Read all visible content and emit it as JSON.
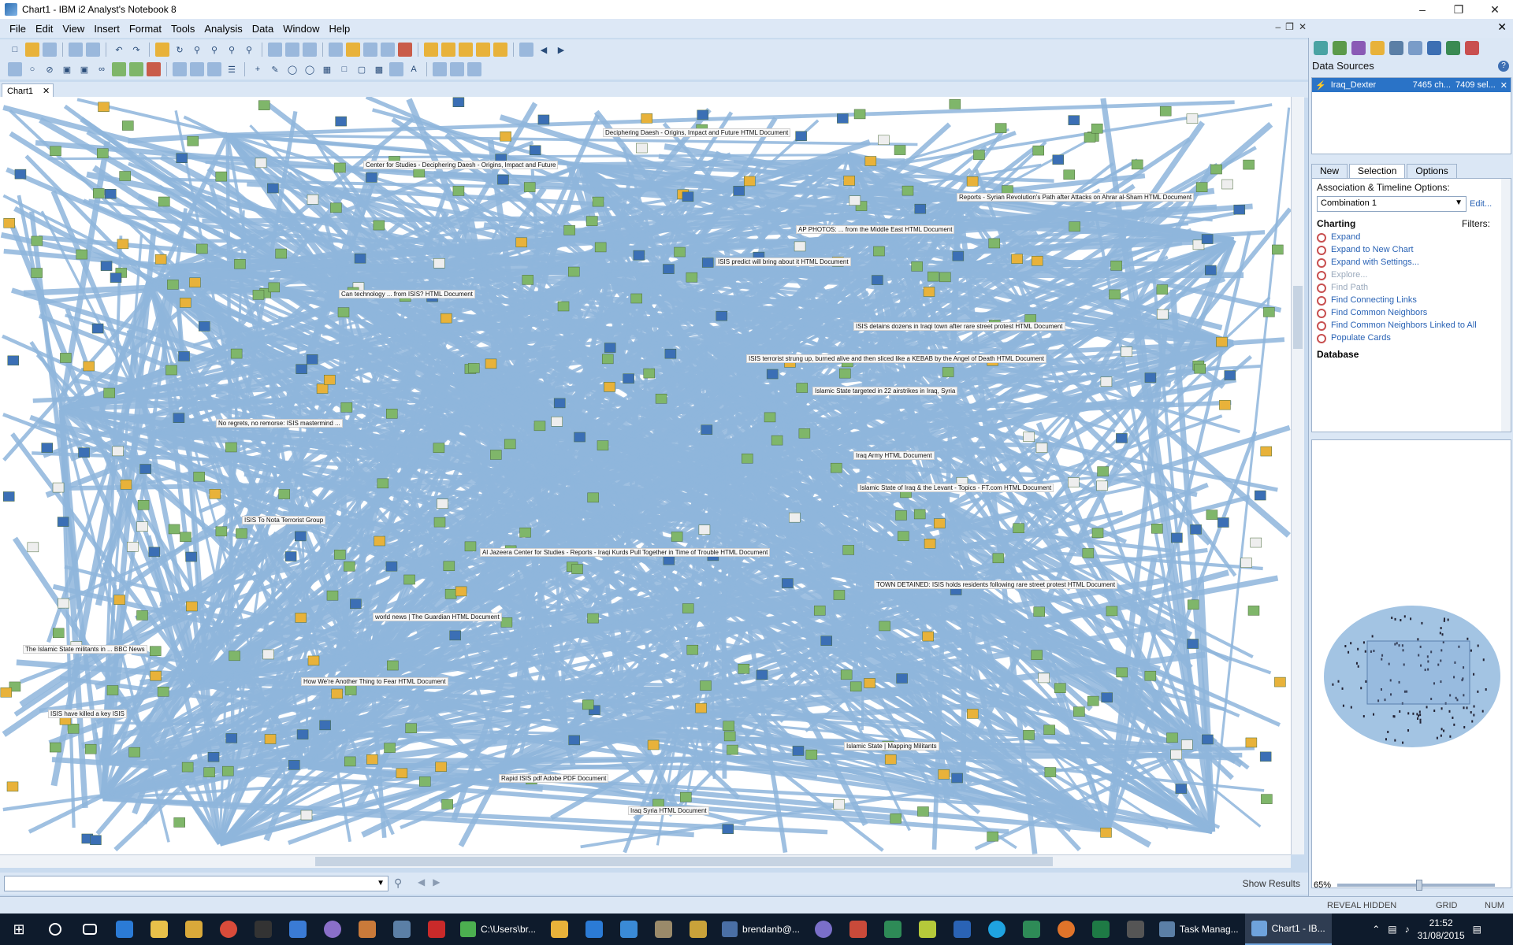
{
  "window": {
    "title": "Chart1 - IBM i2 Analyst's Notebook 8"
  },
  "menu": [
    "File",
    "Edit",
    "View",
    "Insert",
    "Format",
    "Tools",
    "Analysis",
    "Data",
    "Window",
    "Help"
  ],
  "document_tab": {
    "label": "Chart1"
  },
  "chart_labels": [
    "Deciphering Daesh - Origins, Impact and Future HTML Document",
    "Center for Studies - Deciphering Daesh - Origins, Impact and Future",
    "Reports - Syrian Revolution's Path after Attacks on Ahrar al-Sham HTML Document",
    "AP PHOTOS: ... from the Middle East HTML Document",
    "ISIS predict will bring about it HTML Document",
    "Can technology ... from ISIS? HTML Document",
    "ISIS detains dozens in Iraqi town after rare street protest HTML Document",
    "ISIS terrorist strung up, burned alive and then sliced like a KEBAB by the Angel of Death HTML Document",
    "Islamic State targeted in 22 airstrikes in Iraq, Syria",
    "No regrets, no remorse: ISIS mastermind ...",
    "Iraq Army HTML Document",
    "Islamic State of Iraq & the Levant - Topics - FT.com HTML Document",
    "ISIS To Nota Terrorist Group",
    "Al Jazeera Center for Studies - Reports - Iraqi Kurds Pull Together in Time of Trouble HTML Document",
    "TOWN DETAINED: ISIS holds residents following rare street protest HTML Document",
    "world news | The Guardian HTML Document",
    "The Islamic State militants in ... BBC News",
    "How We're Another Thing to Fear HTML Document",
    "ISIS have killed a key ISIS",
    "Islamic State | Mapping Militants",
    "Rapid ISIS pdf Adobe PDF Document",
    "Iraq Syria HTML Document"
  ],
  "search": {
    "value": "",
    "show_results": "Show Results"
  },
  "right_panel": {
    "title": "Data Sources",
    "data_source": {
      "name": "Iraq_Dexter",
      "charts": "7465 ch...",
      "selected": "7409 sel..."
    },
    "tabs": [
      "New",
      "Selection",
      "Options"
    ],
    "active_tab": "Selection",
    "assoc_label": "Association & Timeline Options:",
    "combination": "Combination 1",
    "edit_link": "Edit...",
    "charting_label": "Charting",
    "filters_label": "Filters:",
    "actions": [
      {
        "label": "Expand",
        "dim": false
      },
      {
        "label": "Expand to New Chart",
        "dim": false
      },
      {
        "label": "Expand with Settings...",
        "dim": false
      },
      {
        "label": "Explore...",
        "dim": true
      },
      {
        "label": "Find Path",
        "dim": true
      },
      {
        "label": "Find Connecting Links",
        "dim": false
      },
      {
        "label": "Find Common Neighbors",
        "dim": false
      },
      {
        "label": "Find Common Neighbors Linked to All",
        "dim": false
      },
      {
        "label": "Populate Cards",
        "dim": false
      }
    ],
    "database_label": "Database",
    "zoom": "65%"
  },
  "status": {
    "reveal_hidden": "REVEAL HIDDEN",
    "grid": "GRID",
    "num": "NUM"
  },
  "taskbar": {
    "apps": [
      {
        "label": "C:\\Users\\br...",
        "color": "#4caf50"
      },
      {
        "label": "brendanb@...",
        "color": "#4a6fa5"
      },
      {
        "label": "Task Manag...",
        "color": "#5b7fa6"
      },
      {
        "label": "Chart1 - IB...",
        "color": "#6fa3dc"
      }
    ],
    "time": "21:52",
    "date": "31/08/2015"
  }
}
